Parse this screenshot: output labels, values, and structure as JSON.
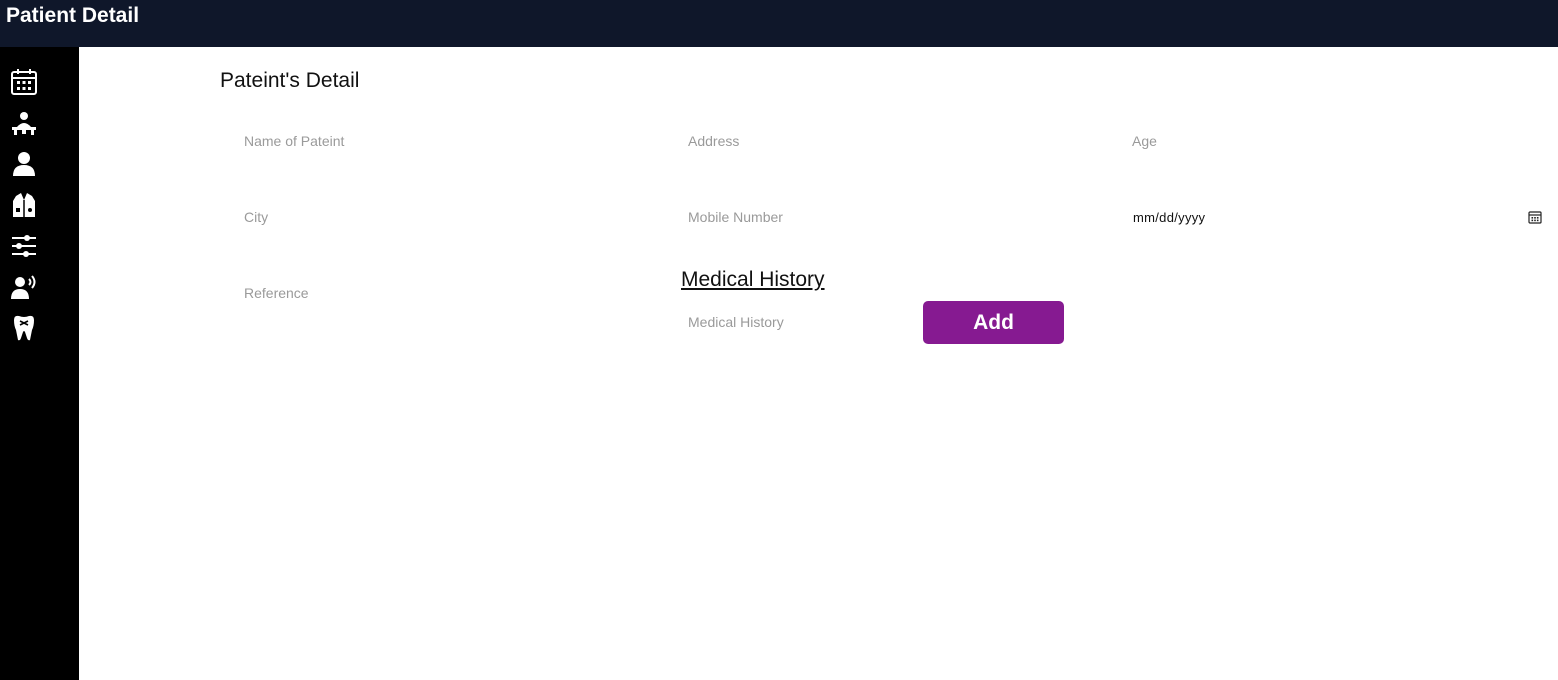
{
  "header": {
    "title": "Patient Detail"
  },
  "sidebar": {
    "items": [
      {
        "icon": "calendar-icon"
      },
      {
        "icon": "doctor-desk-icon"
      },
      {
        "icon": "user-icon"
      },
      {
        "icon": "doctor-coat-icon"
      },
      {
        "icon": "sliders-icon"
      },
      {
        "icon": "user-voice-icon"
      },
      {
        "icon": "tooth-icon"
      }
    ]
  },
  "form": {
    "title": "Pateint's Detail",
    "fields": {
      "name": {
        "placeholder": "Name of Pateint"
      },
      "address": {
        "placeholder": "Address"
      },
      "age": {
        "placeholder": "Age"
      },
      "city": {
        "placeholder": "City"
      },
      "mobile": {
        "placeholder": "Mobile Number"
      },
      "date": {
        "value": "mm/dd/yyyy"
      },
      "reference": {
        "placeholder": "Reference"
      }
    },
    "medical_history": {
      "title": "Medical History",
      "input_placeholder": "Medical History",
      "add_label": "Add"
    }
  },
  "colors": {
    "header_bg": "#0f172a",
    "sidebar_bg": "#000000",
    "accent": "#861a91"
  }
}
